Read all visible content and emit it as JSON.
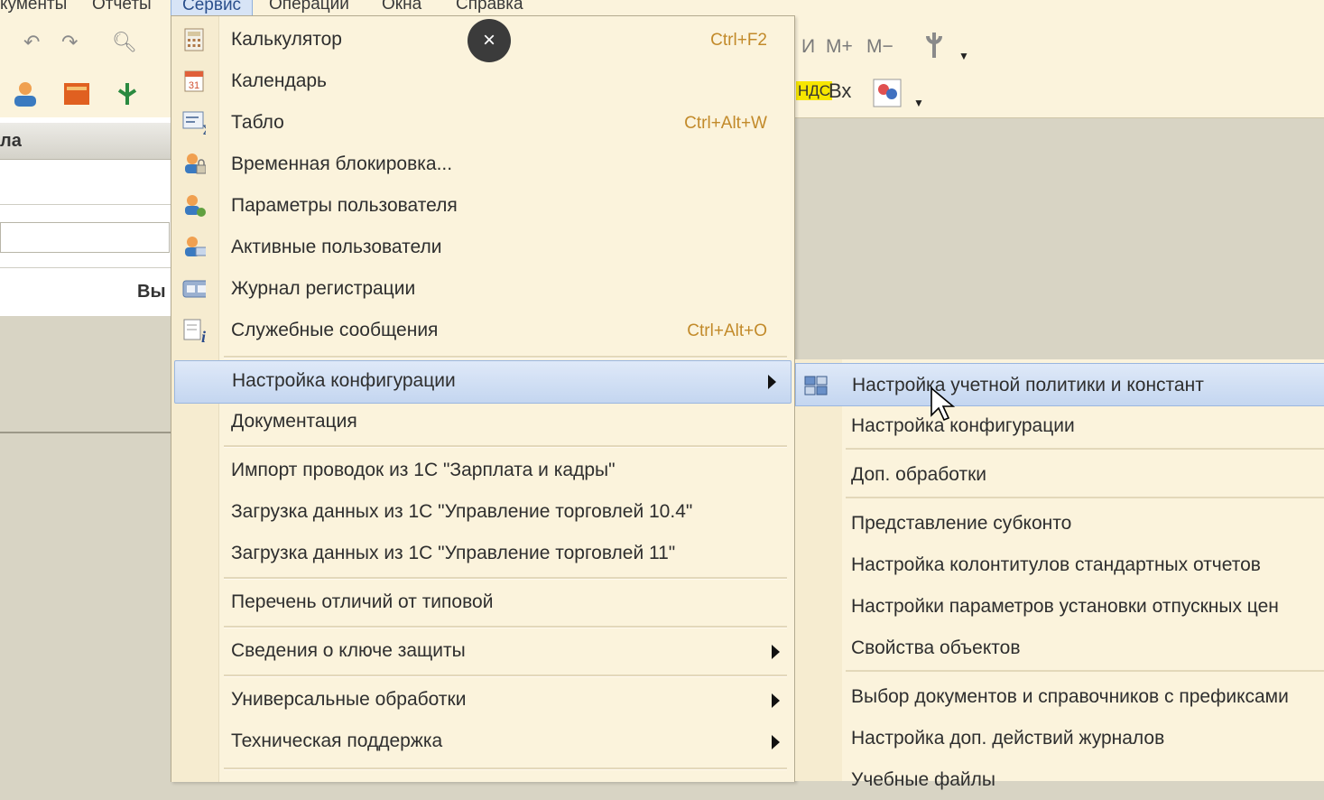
{
  "menubar": {
    "items": [
      "кументы",
      "Отчеты",
      "Сервис",
      "Операции",
      "Окна",
      "Справка"
    ],
    "active_index": 2
  },
  "toolbar": {
    "memory_buttons": [
      "И",
      "M+",
      "M−"
    ],
    "tax_label": "НДС",
    "in_label": "Вх"
  },
  "left_panel": {
    "header": "ла",
    "bottom_text": "Вы"
  },
  "close_button": "×",
  "service_menu": {
    "items": [
      {
        "label": "Калькулятор",
        "shortcut": "Ctrl+F2",
        "icon": "calculator-icon"
      },
      {
        "label": "Календарь",
        "shortcut": "",
        "icon": "calendar-icon"
      },
      {
        "label": "Табло",
        "shortcut": "Ctrl+Alt+W",
        "icon": "scoreboard-icon"
      },
      {
        "label": "Временная блокировка...",
        "shortcut": "",
        "icon": "user-lock-icon"
      },
      {
        "label": "Параметры пользователя",
        "shortcut": "",
        "icon": "user-settings-icon"
      },
      {
        "label": "Активные пользователи",
        "shortcut": "",
        "icon": "active-users-icon"
      },
      {
        "label": "Журнал регистрации",
        "shortcut": "",
        "icon": "log-icon"
      },
      {
        "label": "Служебные сообщения",
        "shortcut": "Ctrl+Alt+O",
        "icon": "info-icon"
      },
      {
        "label": "Настройка конфигурации",
        "submenu": true,
        "highlighted": true
      },
      {
        "label": "Документация"
      },
      {
        "label": "Импорт проводок из 1С \"Зарплата и кадры\""
      },
      {
        "label": "Загрузка данных из 1С \"Управление торговлей 10.4\""
      },
      {
        "label": "Загрузка данных из 1С \"Управление торговлей 11\""
      },
      {
        "label": "Перечень отличий от типовой"
      },
      {
        "label": "Сведения о ключе защиты",
        "submenu": true
      },
      {
        "label": "Универсальные обработки",
        "submenu": true
      },
      {
        "label": "Техническая поддержка",
        "submenu": true
      }
    ]
  },
  "config_submenu": {
    "items": [
      {
        "label": "Настройка учетной политики и констант",
        "highlighted": true,
        "icon": "accounting-policy-icon"
      },
      {
        "label": "Настройка конфигурации"
      },
      {
        "label": "Доп. обработки"
      },
      {
        "label": "Представление субконто"
      },
      {
        "label": "Настройка колонтитулов стандартных отчетов"
      },
      {
        "label": "Настройки параметров установки отпускных цен"
      },
      {
        "label": "Свойства объектов"
      },
      {
        "label": "Выбор документов и справочников с префиксами"
      },
      {
        "label": "Настройка доп. действий журналов"
      },
      {
        "label": "Учебные файлы"
      }
    ]
  },
  "colors": {
    "menu_bg": "#fbf3dc",
    "highlight": "#c4d6f0",
    "shortcut": "#c28a2a",
    "workspace": "#d8d4c4"
  }
}
